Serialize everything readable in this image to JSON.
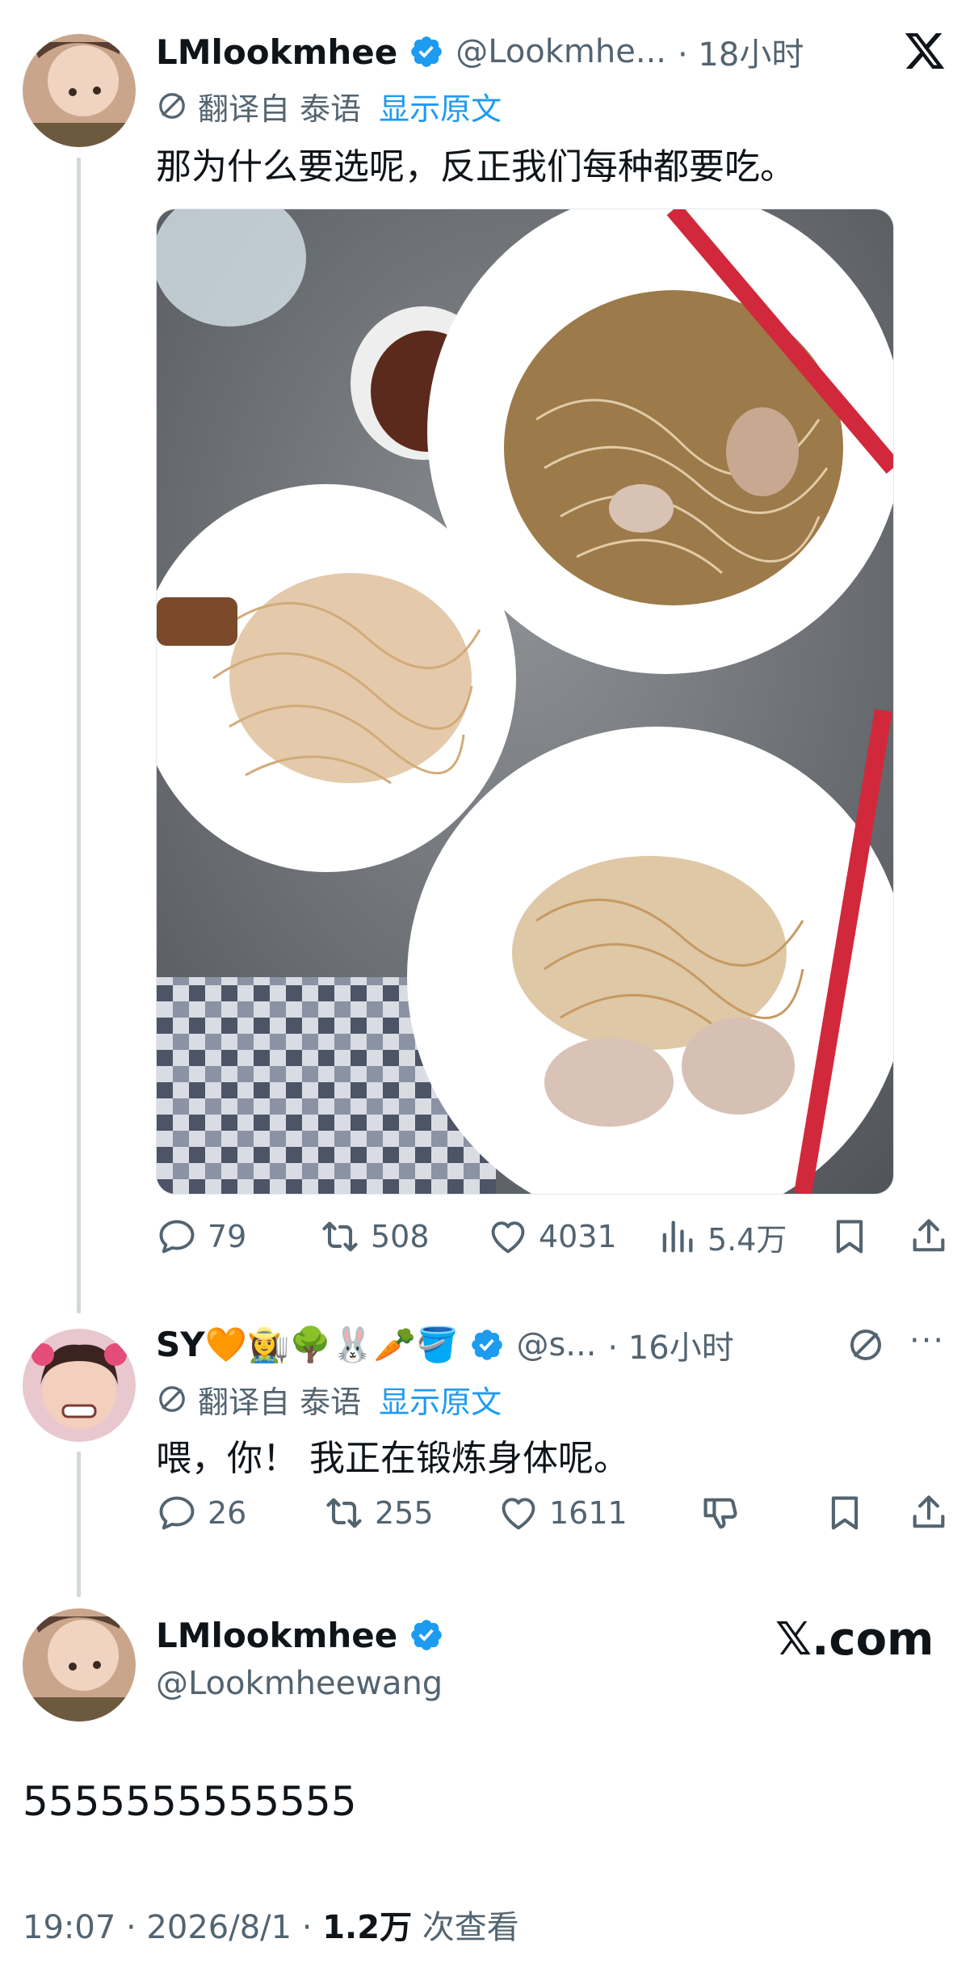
{
  "tweet1": {
    "name": "LMlookmhee",
    "handle": "@Lookmhe...",
    "time": "· 18小时",
    "translated_from": "翻译自 泰语",
    "show_original": "显示原文",
    "text": "那为什么要选呢，反正我们每种都要吃。",
    "stats": {
      "replies": "79",
      "retweets": "508",
      "likes": "4031",
      "views": "5.4万"
    }
  },
  "tweet2": {
    "name": "SY🧡👩‍🌾🌳🐰🥕🪣",
    "handle": "@s...",
    "time": "· 16小时",
    "translated_from": "翻译自 泰语",
    "show_original": "显示原文",
    "text": "喂，你！ 我正在锻炼身体呢。",
    "stats": {
      "replies": "26",
      "retweets": "255",
      "likes": "1611"
    }
  },
  "tweet3": {
    "name": "LMlookmhee",
    "handle": "@Lookmheewang",
    "brand": "𝕏.com",
    "text": "5555555555555",
    "timestamp": "19:07 · 2026/8/1 · ",
    "views_count": "1.2万",
    "views_label": " 次查看"
  },
  "icons": {
    "x_logo": "x-logo-icon",
    "verified": "verified-badge-icon",
    "translate": "translate-icon",
    "reply": "reply-icon",
    "retweet": "retweet-icon",
    "like": "heart-icon",
    "views": "views-bar-chart-icon",
    "bookmark": "bookmark-icon",
    "share": "share-icon",
    "dislike": "thumbs-down-icon",
    "more": "more-dots-icon"
  },
  "colors": {
    "accent": "#1d9bf0",
    "muted": "#536471",
    "text": "#0f1419",
    "line": "#cfd9de"
  }
}
